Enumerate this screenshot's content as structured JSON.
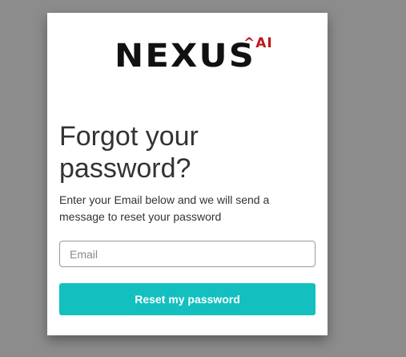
{
  "logo": {
    "word": "NEXUS",
    "sup": "^AI",
    "colors": {
      "word": "#111111",
      "sup": "#c0151b"
    }
  },
  "form": {
    "title": "Forgot your password?",
    "description": "Enter your Email below and we will send a message to reset your password",
    "email_value": "",
    "email_placeholder": "Email",
    "submit_label": "Reset my password"
  },
  "colors": {
    "backdrop": "#8c8c8c",
    "card": "#ffffff",
    "accent": "#13bfbf"
  }
}
